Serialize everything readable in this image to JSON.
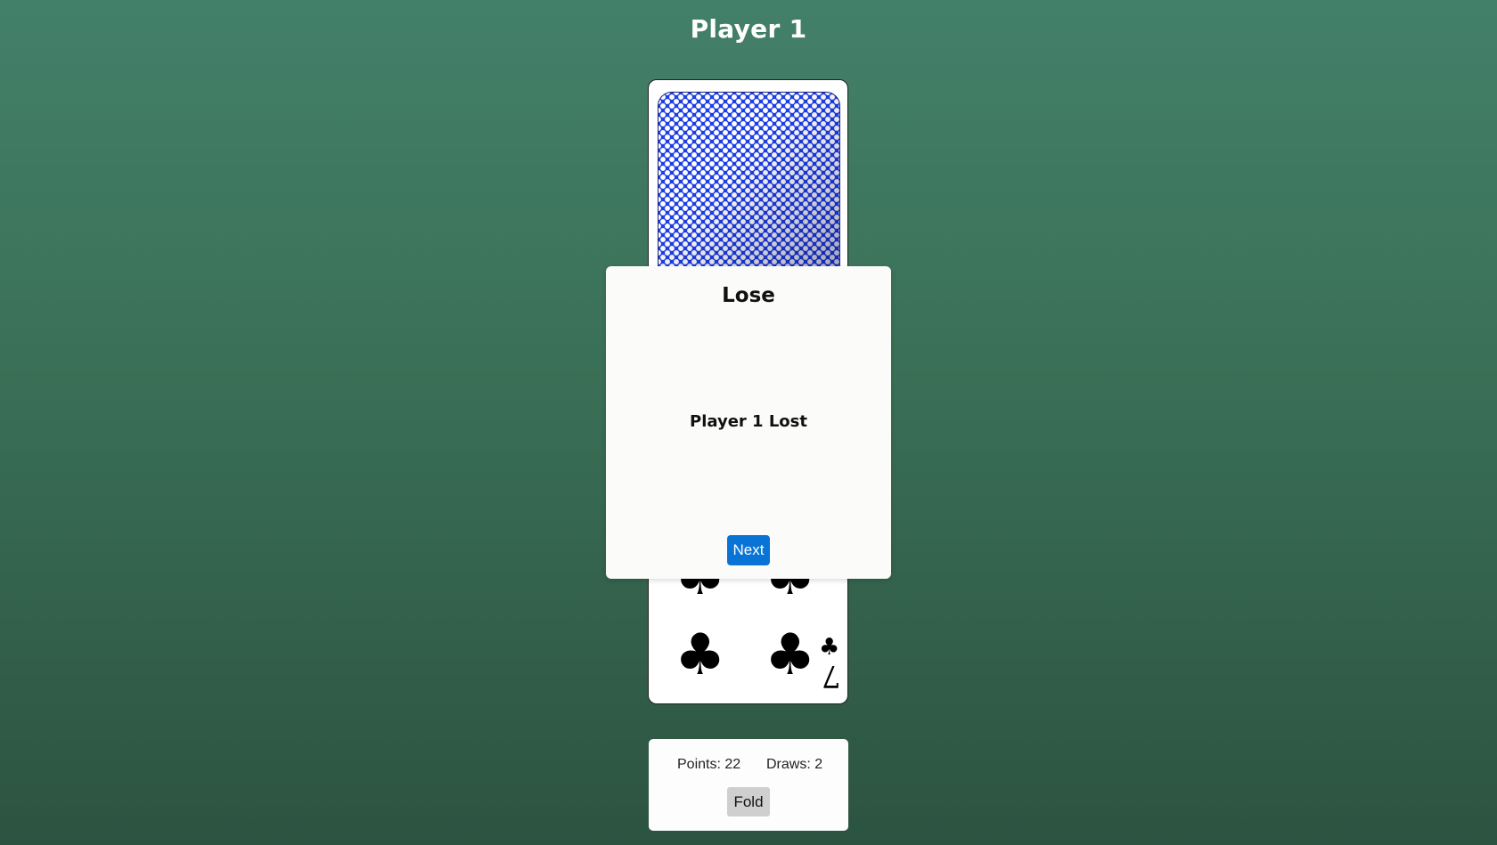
{
  "header": {
    "player_title": "Player 1"
  },
  "card": {
    "rank": "7",
    "suit_symbol": "♣",
    "back_color": "#1e3fe6"
  },
  "result_modal": {
    "title": "Lose",
    "message": "Player 1 Lost",
    "next_label": "Next",
    "accent_color": "#0a74d6"
  },
  "status_panel": {
    "points_text": "Points: 22",
    "draws_text": "Draws: 2",
    "fold_label": "Fold"
  }
}
